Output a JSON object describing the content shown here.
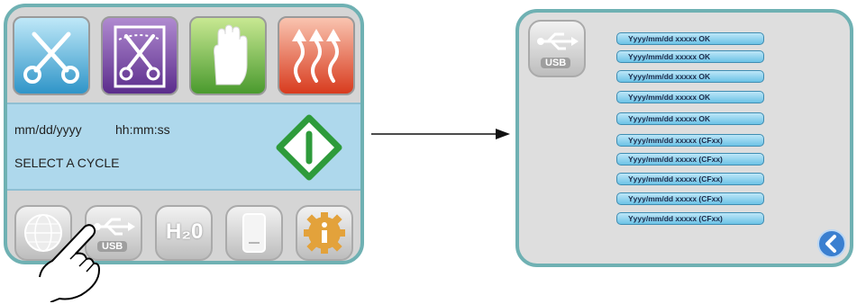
{
  "main_screen": {
    "date_placeholder": "mm/dd/yyyy",
    "time_placeholder": "hh:mm:ss",
    "status_message": "SELECT A CYCLE",
    "usb_button_label": "USB",
    "water_label": "H₂0"
  },
  "usb_screen": {
    "usb_label": "USB",
    "log_entries": [
      "Yyyy/mm/dd xxxxx  OK",
      "Yyyy/mm/dd xxxxx  OK",
      "Yyyy/mm/dd xxxxx  OK",
      "Yyyy/mm/dd xxxxx  OK",
      "Yyyy/mm/dd xxxxx  OK",
      "Yyyy/mm/dd xxxxx  (CFxx)",
      "Yyyy/mm/dd xxxxx  (CFxx)",
      "Yyyy/mm/dd xxxxx  (CFxx)",
      "Yyyy/mm/dd xxxxx  (CFxx)",
      "Yyyy/mm/dd xxxxx  (CFxx)"
    ]
  },
  "colors": {
    "frame": "#6fb1b3",
    "status_bar": "#aed8ec",
    "start_diamond": "#2e9b3b",
    "log_entry": "#6cc2e6"
  }
}
